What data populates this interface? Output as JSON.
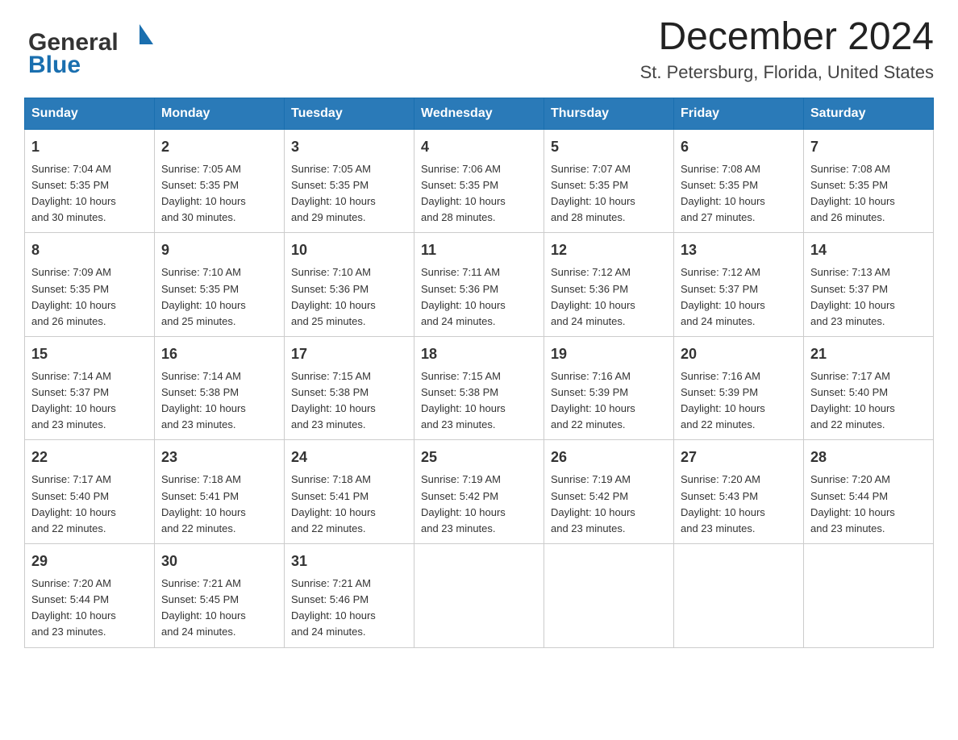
{
  "header": {
    "logo_line1": "General",
    "logo_line2": "Blue",
    "month_title": "December 2024",
    "location": "St. Petersburg, Florida, United States"
  },
  "days_of_week": [
    "Sunday",
    "Monday",
    "Tuesday",
    "Wednesday",
    "Thursday",
    "Friday",
    "Saturday"
  ],
  "weeks": [
    [
      {
        "day": "1",
        "sunrise": "7:04 AM",
        "sunset": "5:35 PM",
        "daylight": "10 hours and 30 minutes."
      },
      {
        "day": "2",
        "sunrise": "7:05 AM",
        "sunset": "5:35 PM",
        "daylight": "10 hours and 30 minutes."
      },
      {
        "day": "3",
        "sunrise": "7:05 AM",
        "sunset": "5:35 PM",
        "daylight": "10 hours and 29 minutes."
      },
      {
        "day": "4",
        "sunrise": "7:06 AM",
        "sunset": "5:35 PM",
        "daylight": "10 hours and 28 minutes."
      },
      {
        "day": "5",
        "sunrise": "7:07 AM",
        "sunset": "5:35 PM",
        "daylight": "10 hours and 28 minutes."
      },
      {
        "day": "6",
        "sunrise": "7:08 AM",
        "sunset": "5:35 PM",
        "daylight": "10 hours and 27 minutes."
      },
      {
        "day": "7",
        "sunrise": "7:08 AM",
        "sunset": "5:35 PM",
        "daylight": "10 hours and 26 minutes."
      }
    ],
    [
      {
        "day": "8",
        "sunrise": "7:09 AM",
        "sunset": "5:35 PM",
        "daylight": "10 hours and 26 minutes."
      },
      {
        "day": "9",
        "sunrise": "7:10 AM",
        "sunset": "5:35 PM",
        "daylight": "10 hours and 25 minutes."
      },
      {
        "day": "10",
        "sunrise": "7:10 AM",
        "sunset": "5:36 PM",
        "daylight": "10 hours and 25 minutes."
      },
      {
        "day": "11",
        "sunrise": "7:11 AM",
        "sunset": "5:36 PM",
        "daylight": "10 hours and 24 minutes."
      },
      {
        "day": "12",
        "sunrise": "7:12 AM",
        "sunset": "5:36 PM",
        "daylight": "10 hours and 24 minutes."
      },
      {
        "day": "13",
        "sunrise": "7:12 AM",
        "sunset": "5:37 PM",
        "daylight": "10 hours and 24 minutes."
      },
      {
        "day": "14",
        "sunrise": "7:13 AM",
        "sunset": "5:37 PM",
        "daylight": "10 hours and 23 minutes."
      }
    ],
    [
      {
        "day": "15",
        "sunrise": "7:14 AM",
        "sunset": "5:37 PM",
        "daylight": "10 hours and 23 minutes."
      },
      {
        "day": "16",
        "sunrise": "7:14 AM",
        "sunset": "5:38 PM",
        "daylight": "10 hours and 23 minutes."
      },
      {
        "day": "17",
        "sunrise": "7:15 AM",
        "sunset": "5:38 PM",
        "daylight": "10 hours and 23 minutes."
      },
      {
        "day": "18",
        "sunrise": "7:15 AM",
        "sunset": "5:38 PM",
        "daylight": "10 hours and 23 minutes."
      },
      {
        "day": "19",
        "sunrise": "7:16 AM",
        "sunset": "5:39 PM",
        "daylight": "10 hours and 22 minutes."
      },
      {
        "day": "20",
        "sunrise": "7:16 AM",
        "sunset": "5:39 PM",
        "daylight": "10 hours and 22 minutes."
      },
      {
        "day": "21",
        "sunrise": "7:17 AM",
        "sunset": "5:40 PM",
        "daylight": "10 hours and 22 minutes."
      }
    ],
    [
      {
        "day": "22",
        "sunrise": "7:17 AM",
        "sunset": "5:40 PM",
        "daylight": "10 hours and 22 minutes."
      },
      {
        "day": "23",
        "sunrise": "7:18 AM",
        "sunset": "5:41 PM",
        "daylight": "10 hours and 22 minutes."
      },
      {
        "day": "24",
        "sunrise": "7:18 AM",
        "sunset": "5:41 PM",
        "daylight": "10 hours and 22 minutes."
      },
      {
        "day": "25",
        "sunrise": "7:19 AM",
        "sunset": "5:42 PM",
        "daylight": "10 hours and 23 minutes."
      },
      {
        "day": "26",
        "sunrise": "7:19 AM",
        "sunset": "5:42 PM",
        "daylight": "10 hours and 23 minutes."
      },
      {
        "day": "27",
        "sunrise": "7:20 AM",
        "sunset": "5:43 PM",
        "daylight": "10 hours and 23 minutes."
      },
      {
        "day": "28",
        "sunrise": "7:20 AM",
        "sunset": "5:44 PM",
        "daylight": "10 hours and 23 minutes."
      }
    ],
    [
      {
        "day": "29",
        "sunrise": "7:20 AM",
        "sunset": "5:44 PM",
        "daylight": "10 hours and 23 minutes."
      },
      {
        "day": "30",
        "sunrise": "7:21 AM",
        "sunset": "5:45 PM",
        "daylight": "10 hours and 24 minutes."
      },
      {
        "day": "31",
        "sunrise": "7:21 AM",
        "sunset": "5:46 PM",
        "daylight": "10 hours and 24 minutes."
      },
      null,
      null,
      null,
      null
    ]
  ],
  "labels": {
    "sunrise_prefix": "Sunrise: ",
    "sunset_prefix": "Sunset: ",
    "daylight_prefix": "Daylight: "
  }
}
